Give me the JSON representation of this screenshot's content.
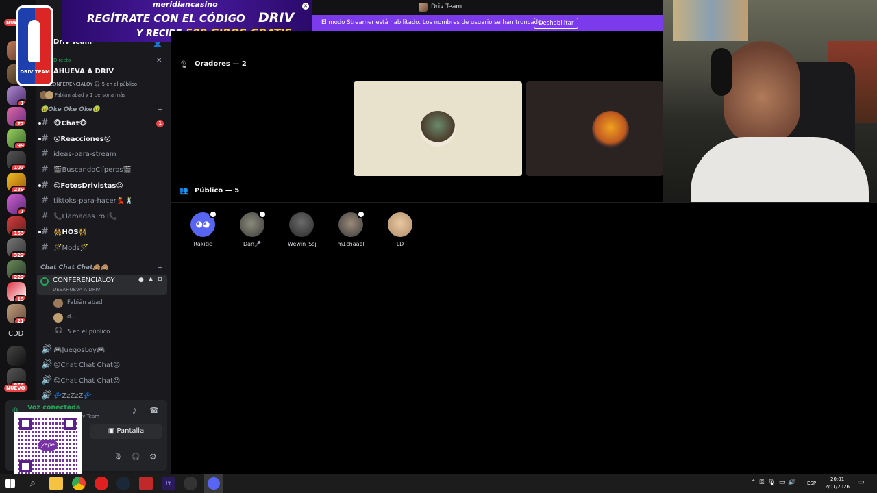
{
  "titlebar": {
    "server_name": "Driv Team"
  },
  "ad": {
    "brand": "meridiancasino",
    "line1": "REGÍTRATE CON EL CÓDIGO",
    "code": "DRIV",
    "line2_prefix": "Y RECIBE",
    "line2_highlight": "500 GIROS GRATIS",
    "logo_text": "DRIV TEAM"
  },
  "streamer_bar": {
    "message": "El modo Streamer está habilitado. Los nombres de usuario se han truncado.",
    "button": "Deshabilitar"
  },
  "rail": {
    "top_badge": "NUE",
    "bottom_badge": "NUEVO",
    "cdd_label": "CDD",
    "badges": [
      "1",
      "72",
      "99",
      "103",
      "239",
      "1",
      "153",
      "322",
      "222",
      "15",
      "21",
      "856"
    ]
  },
  "sidebar": {
    "server_title": "Driv Team",
    "stage": {
      "live_label": "Directo",
      "title": "AHUEVA A DRIV",
      "channel": "CONFERENCIALOY",
      "listeners": "5 en el público",
      "members_text": "Fabián abad y 1 persona más"
    },
    "category1": "🤢Oke Oke Oke🤢",
    "channels": [
      {
        "name": "🐵Chat🐵",
        "badge": "1"
      },
      {
        "name": "😮Reacciones😮"
      },
      {
        "name": "ideas-para-stream"
      },
      {
        "name": "🎬BuscandoClíperos🎬"
      },
      {
        "name": "😍FotosDrivistas😍"
      },
      {
        "name": "tiktoks-para-hacer💃🕺"
      },
      {
        "name": "📞LlamadasTroll📞"
      },
      {
        "name": "👯HOS👯"
      },
      {
        "name": "🪄Mods🪄"
      }
    ],
    "category2": "Chat Chat Chat🙈🙈",
    "voice": {
      "active": {
        "name": "CONFERENCIALOY",
        "subtitle": "DESAHUEVA A DRIV",
        "members": [
          "Fabián abad",
          "d..."
        ],
        "listeners": "5 en el público"
      },
      "others": [
        "🎮JuegosLoy🎮",
        "😡Chat Chat Chat😡",
        "😡Chat Chat Chat😡",
        "💤ZzZzZ💤"
      ]
    }
  },
  "voice_panel": {
    "status": "Voz conectada",
    "server": "Driv Team",
    "screen_button": "Pantalla",
    "qr_label": "yape"
  },
  "stage_view": {
    "speakers_header": "Oradores — 2",
    "audience_header": "Público — 5",
    "audience": [
      {
        "name": "Rakitic"
      },
      {
        "name": "Dan🎤"
      },
      {
        "name": "Wewin_Ssj"
      },
      {
        "name": "m1chaael"
      },
      {
        "name": "LD"
      }
    ]
  },
  "taskbar": {
    "lang": "ESP",
    "time": "20:01",
    "date": "2/01/2026"
  },
  "colors": {
    "streamer_purple": "#7c3aed",
    "badge_red": "#ed4245",
    "voice_green": "#23a55a",
    "speaker_tile_bg": "#e8e2cc",
    "dark_tile_bg": "#2b2222"
  }
}
